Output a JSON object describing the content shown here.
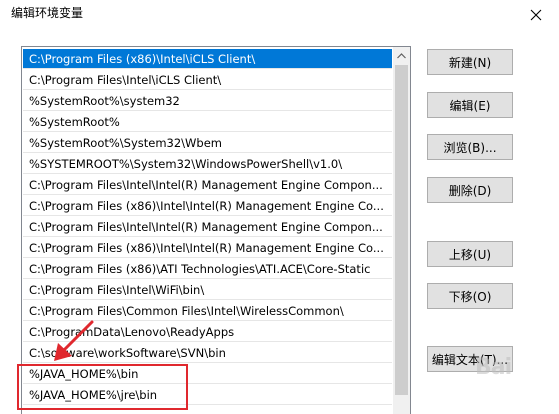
{
  "window": {
    "title": "编辑环境变量"
  },
  "list": {
    "items": [
      "C:\\Program Files (x86)\\Intel\\iCLS Client\\",
      "C:\\Program Files\\Intel\\iCLS Client\\",
      "%SystemRoot%\\system32",
      "%SystemRoot%",
      "%SystemRoot%\\System32\\Wbem",
      "%SYSTEMROOT%\\System32\\WindowsPowerShell\\v1.0\\",
      "C:\\Program Files\\Intel\\Intel(R) Management Engine Compon...",
      "C:\\Program Files (x86)\\Intel\\Intel(R) Management Engine Co...",
      "C:\\Program Files\\Intel\\Intel(R) Management Engine Compon...",
      "C:\\Program Files (x86)\\Intel\\Intel(R) Management Engine Co...",
      "C:\\Program Files (x86)\\ATI Technologies\\ATI.ACE\\Core-Static",
      "C:\\Program Files\\Intel\\WiFi\\bin\\",
      "C:\\Program Files\\Common Files\\Intel\\WirelessCommon\\",
      "C:\\ProgramData\\Lenovo\\ReadyApps",
      "C:\\software\\workSoftware\\SVN\\bin",
      "%JAVA_HOME%\\bin",
      "%JAVA_HOME%\\jre\\bin"
    ],
    "selected_index": 0
  },
  "buttons": {
    "new": "新建(N)",
    "edit": "编辑(E)",
    "browse": "浏览(B)...",
    "delete": "删除(D)",
    "move_up": "上移(U)",
    "move_down": "下移(O)",
    "edit_text": "编辑文本(T)..."
  },
  "watermark": "Bai"
}
